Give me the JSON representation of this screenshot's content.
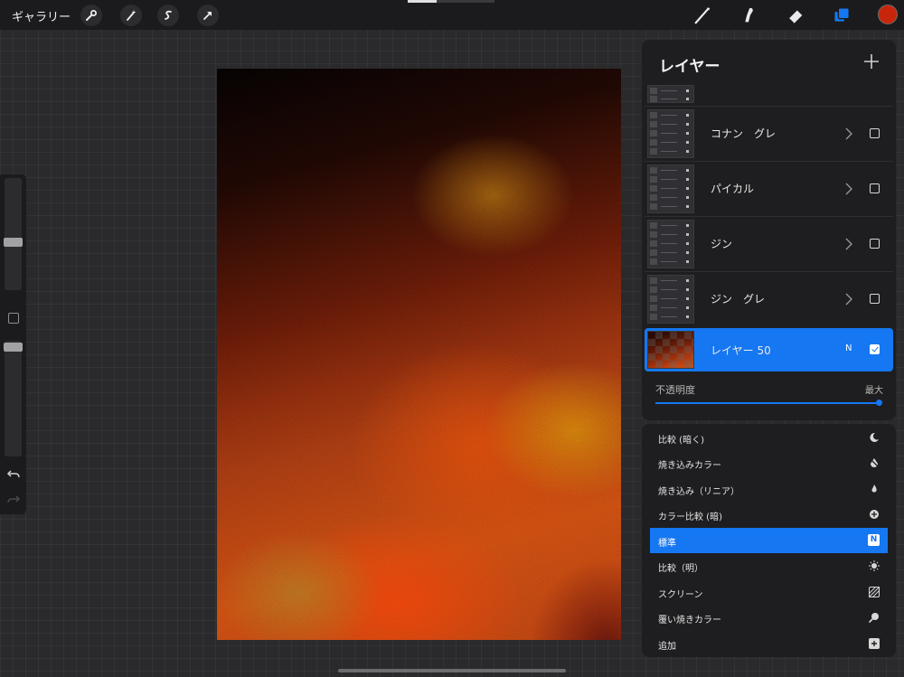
{
  "topbar": {
    "gallery_label": "ギャラリー",
    "left_tools": [
      "wrench-icon",
      "magic-wand-icon",
      "selection-icon",
      "move-arrow-icon"
    ],
    "right_tools": [
      "brush-icon",
      "smudge-icon",
      "eraser-icon",
      "layers-icon"
    ],
    "current_color": "#c8260c",
    "accent": "#1577f1"
  },
  "sidebar": {
    "brush_size_level": 0.42,
    "opacity_level": 0.98
  },
  "layers_panel": {
    "title": "レイヤー",
    "layers": [
      {
        "name": "",
        "visible": false,
        "group": true,
        "partial": true
      },
      {
        "name": "コナン　グレ",
        "visible": false,
        "group": true
      },
      {
        "name": "パイカル",
        "visible": false,
        "group": true
      },
      {
        "name": "ジン",
        "visible": false,
        "group": true
      },
      {
        "name": "ジン　グレ",
        "visible": false,
        "group": true
      },
      {
        "name": "レイヤー 50",
        "visible": true,
        "group": false,
        "active": true,
        "blend_short": "N"
      }
    ],
    "opacity": {
      "label": "不透明度",
      "max_label": "最大",
      "value": 1.0
    }
  },
  "blend_modes": {
    "items": [
      {
        "label": "比較 (暗く)",
        "icon": "moon-icon"
      },
      {
        "label": "焼き込みカラー",
        "icon": "burn-drop-icon"
      },
      {
        "label": "焼き込み（リニア）",
        "icon": "flame-icon"
      },
      {
        "label": "カラー比較 (暗)",
        "icon": "plus-circle-icon"
      },
      {
        "label": "標準",
        "icon": "n-square-icon",
        "selected": true
      },
      {
        "label": "比較（明）",
        "icon": "sun-burst-icon"
      },
      {
        "label": "スクリーン",
        "icon": "hatch-square-icon"
      },
      {
        "label": "覆い焼きカラー",
        "icon": "dodge-icon"
      },
      {
        "label": "追加",
        "icon": "plus-square-icon"
      }
    ],
    "n_badge": "N"
  }
}
